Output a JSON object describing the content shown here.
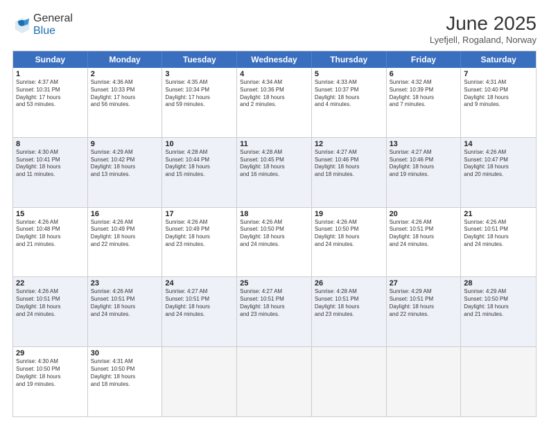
{
  "header": {
    "logo_general": "General",
    "logo_blue": "Blue",
    "title": "June 2025",
    "subtitle": "Lyefjell, Rogaland, Norway"
  },
  "weekdays": [
    "Sunday",
    "Monday",
    "Tuesday",
    "Wednesday",
    "Thursday",
    "Friday",
    "Saturday"
  ],
  "rows": [
    [
      {
        "day": "",
        "info": ""
      },
      {
        "day": "2",
        "info": "Sunrise: 4:36 AM\nSunset: 10:33 PM\nDaylight: 17 hours\nand 56 minutes."
      },
      {
        "day": "3",
        "info": "Sunrise: 4:35 AM\nSunset: 10:34 PM\nDaylight: 17 hours\nand 59 minutes."
      },
      {
        "day": "4",
        "info": "Sunrise: 4:34 AM\nSunset: 10:36 PM\nDaylight: 18 hours\nand 2 minutes."
      },
      {
        "day": "5",
        "info": "Sunrise: 4:33 AM\nSunset: 10:37 PM\nDaylight: 18 hours\nand 4 minutes."
      },
      {
        "day": "6",
        "info": "Sunrise: 4:32 AM\nSunset: 10:39 PM\nDaylight: 18 hours\nand 7 minutes."
      },
      {
        "day": "7",
        "info": "Sunrise: 4:31 AM\nSunset: 10:40 PM\nDaylight: 18 hours\nand 9 minutes."
      }
    ],
    [
      {
        "day": "8",
        "info": "Sunrise: 4:30 AM\nSunset: 10:41 PM\nDaylight: 18 hours\nand 11 minutes."
      },
      {
        "day": "9",
        "info": "Sunrise: 4:29 AM\nSunset: 10:42 PM\nDaylight: 18 hours\nand 13 minutes."
      },
      {
        "day": "10",
        "info": "Sunrise: 4:28 AM\nSunset: 10:44 PM\nDaylight: 18 hours\nand 15 minutes."
      },
      {
        "day": "11",
        "info": "Sunrise: 4:28 AM\nSunset: 10:45 PM\nDaylight: 18 hours\nand 16 minutes."
      },
      {
        "day": "12",
        "info": "Sunrise: 4:27 AM\nSunset: 10:46 PM\nDaylight: 18 hours\nand 18 minutes."
      },
      {
        "day": "13",
        "info": "Sunrise: 4:27 AM\nSunset: 10:46 PM\nDaylight: 18 hours\nand 19 minutes."
      },
      {
        "day": "14",
        "info": "Sunrise: 4:26 AM\nSunset: 10:47 PM\nDaylight: 18 hours\nand 20 minutes."
      }
    ],
    [
      {
        "day": "15",
        "info": "Sunrise: 4:26 AM\nSunset: 10:48 PM\nDaylight: 18 hours\nand 21 minutes."
      },
      {
        "day": "16",
        "info": "Sunrise: 4:26 AM\nSunset: 10:49 PM\nDaylight: 18 hours\nand 22 minutes."
      },
      {
        "day": "17",
        "info": "Sunrise: 4:26 AM\nSunset: 10:49 PM\nDaylight: 18 hours\nand 23 minutes."
      },
      {
        "day": "18",
        "info": "Sunrise: 4:26 AM\nSunset: 10:50 PM\nDaylight: 18 hours\nand 24 minutes."
      },
      {
        "day": "19",
        "info": "Sunrise: 4:26 AM\nSunset: 10:50 PM\nDaylight: 18 hours\nand 24 minutes."
      },
      {
        "day": "20",
        "info": "Sunrise: 4:26 AM\nSunset: 10:51 PM\nDaylight: 18 hours\nand 24 minutes."
      },
      {
        "day": "21",
        "info": "Sunrise: 4:26 AM\nSunset: 10:51 PM\nDaylight: 18 hours\nand 24 minutes."
      }
    ],
    [
      {
        "day": "22",
        "info": "Sunrise: 4:26 AM\nSunset: 10:51 PM\nDaylight: 18 hours\nand 24 minutes."
      },
      {
        "day": "23",
        "info": "Sunrise: 4:26 AM\nSunset: 10:51 PM\nDaylight: 18 hours\nand 24 minutes."
      },
      {
        "day": "24",
        "info": "Sunrise: 4:27 AM\nSunset: 10:51 PM\nDaylight: 18 hours\nand 24 minutes."
      },
      {
        "day": "25",
        "info": "Sunrise: 4:27 AM\nSunset: 10:51 PM\nDaylight: 18 hours\nand 23 minutes."
      },
      {
        "day": "26",
        "info": "Sunrise: 4:28 AM\nSunset: 10:51 PM\nDaylight: 18 hours\nand 23 minutes."
      },
      {
        "day": "27",
        "info": "Sunrise: 4:29 AM\nSunset: 10:51 PM\nDaylight: 18 hours\nand 22 minutes."
      },
      {
        "day": "28",
        "info": "Sunrise: 4:29 AM\nSunset: 10:50 PM\nDaylight: 18 hours\nand 21 minutes."
      }
    ],
    [
      {
        "day": "29",
        "info": "Sunrise: 4:30 AM\nSunset: 10:50 PM\nDaylight: 18 hours\nand 19 minutes."
      },
      {
        "day": "30",
        "info": "Sunrise: 4:31 AM\nSunset: 10:50 PM\nDaylight: 18 hours\nand 18 minutes."
      },
      {
        "day": "",
        "info": ""
      },
      {
        "day": "",
        "info": ""
      },
      {
        "day": "",
        "info": ""
      },
      {
        "day": "",
        "info": ""
      },
      {
        "day": "",
        "info": ""
      }
    ]
  ],
  "row1_first": {
    "day": "1",
    "info": "Sunrise: 4:37 AM\nSunset: 10:31 PM\nDaylight: 17 hours\nand 53 minutes."
  }
}
